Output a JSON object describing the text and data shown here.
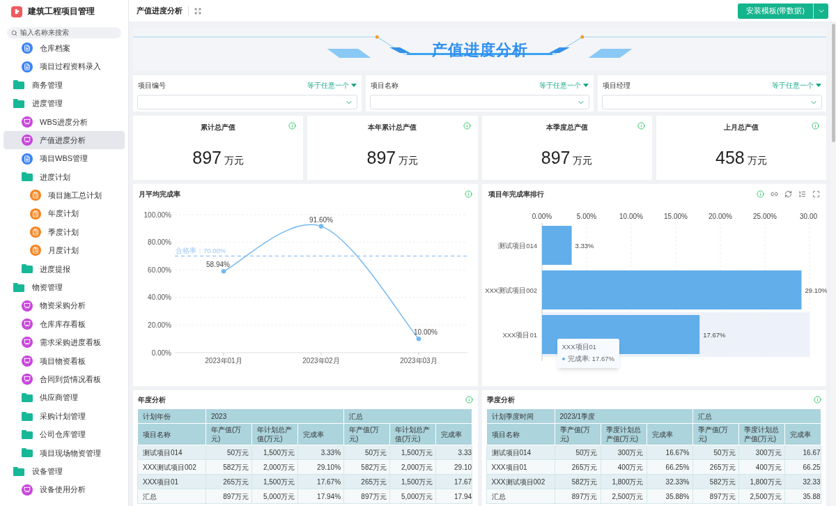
{
  "app": {
    "title": "建筑工程项目管理"
  },
  "sidebar": {
    "search_placeholder": "输入名称来搜索",
    "continued_items": [
      {
        "label": "仓库档案",
        "kind": "doc",
        "selected": false
      },
      {
        "label": "项目过程资料录入",
        "kind": "doc",
        "selected": false
      }
    ],
    "items": [
      {
        "label": "商务管理",
        "kind": "folder",
        "selected": false
      },
      {
        "label": "进度管理",
        "kind": "folder",
        "selected": false,
        "children": [
          {
            "label": "WBS进度分析",
            "kind": "chart",
            "selected": false
          },
          {
            "label": "产值进度分析",
            "kind": "chart",
            "selected": true
          },
          {
            "label": "项目WBS管理",
            "kind": "doc",
            "selected": false
          },
          {
            "label": "进度计划",
            "kind": "folder",
            "selected": false,
            "children": [
              {
                "label": "项目施工总计划",
                "kind": "plan",
                "selected": false
              },
              {
                "label": "年度计划",
                "kind": "plan",
                "selected": false
              },
              {
                "label": "季度计划",
                "kind": "plan",
                "selected": false
              },
              {
                "label": "月度计划",
                "kind": "plan",
                "selected": false
              }
            ]
          },
          {
            "label": "进度提报",
            "kind": "folder",
            "selected": false
          }
        ]
      },
      {
        "label": "物资管理",
        "kind": "folder",
        "selected": false,
        "children": [
          {
            "label": "物资采购分析",
            "kind": "chart",
            "selected": false
          },
          {
            "label": "仓库库存看板",
            "kind": "chart",
            "selected": false
          },
          {
            "label": "需求采购进度看板",
            "kind": "chart",
            "selected": false
          },
          {
            "label": "项目物资看板",
            "kind": "chart",
            "selected": false
          },
          {
            "label": "合同到货情况看板",
            "kind": "chart",
            "selected": false
          },
          {
            "label": "供应商管理",
            "kind": "folder",
            "selected": false
          },
          {
            "label": "采购计划管理",
            "kind": "folder",
            "selected": false
          },
          {
            "label": "公司仓库管理",
            "kind": "folder",
            "selected": false
          },
          {
            "label": "项目现场物资管理",
            "kind": "folder",
            "selected": false
          }
        ]
      },
      {
        "label": "设备管理",
        "kind": "folder",
        "selected": false,
        "children": [
          {
            "label": "设备使用分析",
            "kind": "chart",
            "selected": false
          }
        ]
      }
    ]
  },
  "header": {
    "title": "产值进度分析",
    "install_button": "安装模板(带数据)"
  },
  "banner": {
    "title": "产值进度分析"
  },
  "filters": [
    {
      "label": "项目编号",
      "operator": "等于任意一个"
    },
    {
      "label": "项目名称",
      "operator": "等于任意一个"
    },
    {
      "label": "项目经理",
      "operator": "等于任意一个"
    }
  ],
  "kpis": [
    {
      "title": "累计总产值",
      "value": "897",
      "unit": "万元"
    },
    {
      "title": "本年累计总产值",
      "value": "897",
      "unit": "万元"
    },
    {
      "title": "本季度总产值",
      "value": "897",
      "unit": "万元"
    },
    {
      "title": "上月总产值",
      "value": "458",
      "unit": "万元"
    }
  ],
  "monthly_card": {
    "title": "月平均完成率",
    "chart_data": {
      "type": "line",
      "categories": [
        "2023年01月",
        "2023年02月",
        "2023年03月"
      ],
      "series": [
        {
          "color": "#74b9f0",
          "marker": "circle",
          "values": [
            58.94,
            91.6,
            10.0
          ]
        }
      ],
      "grid": true,
      "ylim": [
        0,
        100
      ],
      "yticks": [
        {
          "value": 0,
          "label": "0.00%"
        },
        {
          "value": 20,
          "label": "20.00%"
        },
        {
          "value": 40,
          "label": "40.00%"
        },
        {
          "value": 60,
          "label": "60.00%"
        },
        {
          "value": 80,
          "label": "80.00%"
        },
        {
          "value": 100,
          "label": "100.00%"
        }
      ],
      "value_labels": [
        "58.94%",
        "91.60%",
        "10.00%"
      ],
      "ref_lines": [
        {
          "axis": "y",
          "value": 70,
          "label": "合格率：70.00%"
        }
      ]
    }
  },
  "rank_card": {
    "title": "项目年完成率排行",
    "chart_data": {
      "type": "bar",
      "orientation": "horizontal",
      "categories": [
        "测试项目014",
        "XXX测试项目002",
        "XXX项目01"
      ],
      "series": [
        {
          "color": "#62aeea",
          "values": [
            3.33,
            29.1,
            17.67
          ]
        }
      ],
      "grid": true,
      "xlim": [
        0,
        30
      ],
      "xticks": [
        {
          "value": 0,
          "label": "0.00%"
        },
        {
          "value": 5,
          "label": "5.00%"
        },
        {
          "value": 10,
          "label": "10.00%"
        },
        {
          "value": 15,
          "label": "15.00%"
        },
        {
          "value": 20,
          "label": "20.00%"
        },
        {
          "value": 25,
          "label": "25.00%"
        },
        {
          "value": 30,
          "label": "30.00"
        }
      ],
      "value_labels": [
        "3.33%",
        "29.10%",
        "17.67%"
      ]
    },
    "tooltip": {
      "title": "XXX项目01",
      "text": "完成率: 17.67%"
    }
  },
  "tables": [
    {
      "title": "年度分析",
      "group_header": {
        "corner": "计划年份",
        "groups": [
          "2023",
          "汇总"
        ]
      },
      "columns": [
        "项目名称",
        "年产值(万元)",
        "年计划总产值(万元)",
        "完成率",
        "年产值(万元)",
        "年计划总产值(万元)",
        "完成率"
      ],
      "rows": [
        [
          "测试项目014",
          "50万元",
          "1,500万元",
          "3.33%",
          "50万元",
          "1,500万元",
          "3.33"
        ],
        [
          "XXX测试项目002",
          "582万元",
          "2,000万元",
          "29.10%",
          "582万元",
          "2,000万元",
          "29.10"
        ],
        [
          "XXX项目01",
          "265万元",
          "1,500万元",
          "17.67%",
          "265万元",
          "1,500万元",
          "17.67"
        ],
        [
          "汇总",
          "897万元",
          "5,000万元",
          "17.94%",
          "897万元",
          "5,000万元",
          "17.94"
        ]
      ]
    },
    {
      "title": "季度分析",
      "group_header": {
        "corner": "计划季度时间",
        "groups": [
          "2023/1季度",
          "汇总"
        ]
      },
      "columns": [
        "项目名称",
        "季产值(万元)",
        "季度计划总产值(万元)",
        "完成率",
        "季产值(万元)",
        "季度计划总产值(万元)",
        "完成率"
      ],
      "rows": [
        [
          "测试项目014",
          "50万元",
          "300万元",
          "16.67%",
          "50万元",
          "300万元",
          "16.67"
        ],
        [
          "XXX项目01",
          "265万元",
          "400万元",
          "66.25%",
          "265万元",
          "400万元",
          "66.25"
        ],
        [
          "XXX测试项目002",
          "582万元",
          "1,800万元",
          "32.33%",
          "582万元",
          "1,800万元",
          "32.33"
        ],
        [
          "汇总",
          "897万元",
          "2,500万元",
          "35.88%",
          "897万元",
          "2,500万元",
          "35.88"
        ]
      ]
    }
  ]
}
